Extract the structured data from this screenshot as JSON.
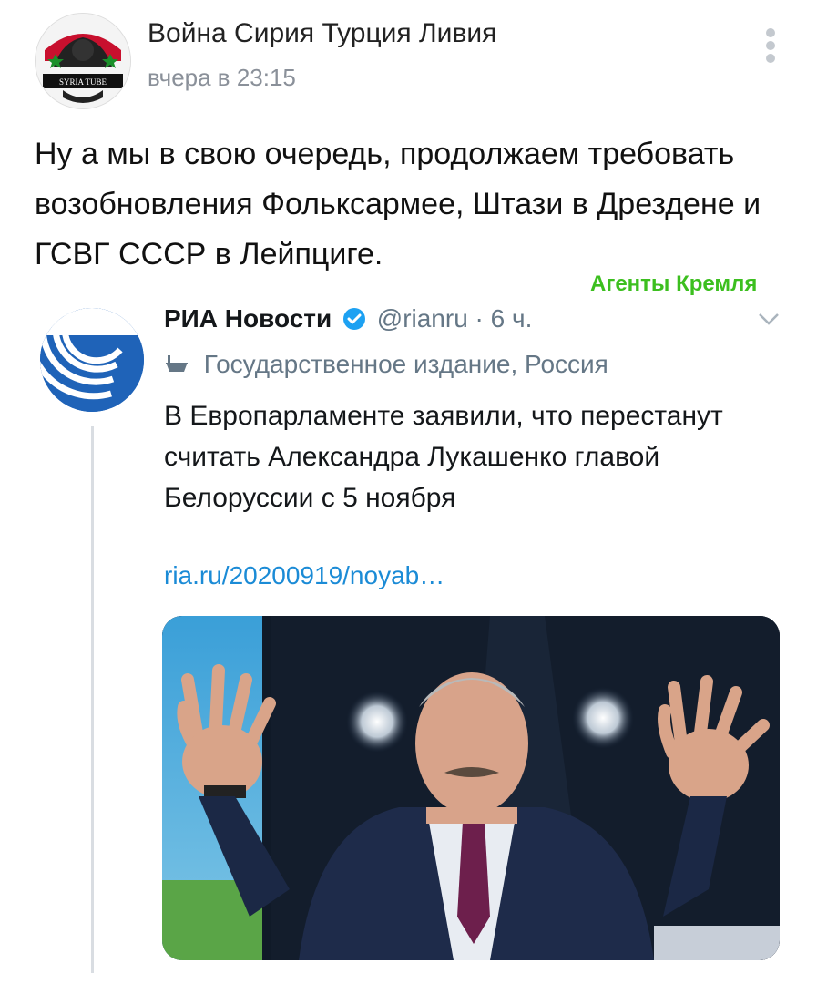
{
  "post": {
    "author": "Война Сирия Турция Ливия",
    "time": "вчера в 23:15",
    "avatar_badge": "SYRIA TUBE",
    "text": "Ну а мы в свою очередь, продолжаем требовать возобновления Фольксармее, Штази в Дрездене и ГСВГ СССР в Лейпциге.",
    "watermark": "Агенты Кремля"
  },
  "tweet": {
    "name": "РИА Новости",
    "handle": "@rianru · 6 ч.",
    "label": "Государственное издание, Россия",
    "text": "В Европарламенте заявили, что перестанут считать Александра Лукашенко главой Белоруссии с 5 ноября",
    "link": "ria.ru/20200919/noyab…"
  },
  "icons": {
    "more": "more-vertical-icon",
    "verified": "verified-badge-icon",
    "chevron": "chevron-down-icon",
    "government": "government-label-icon"
  },
  "colors": {
    "link": "#1b8bd6",
    "watermark": "#3cbf1f",
    "ria_blue": "#1f63b8",
    "verified": "#1da1f2"
  }
}
